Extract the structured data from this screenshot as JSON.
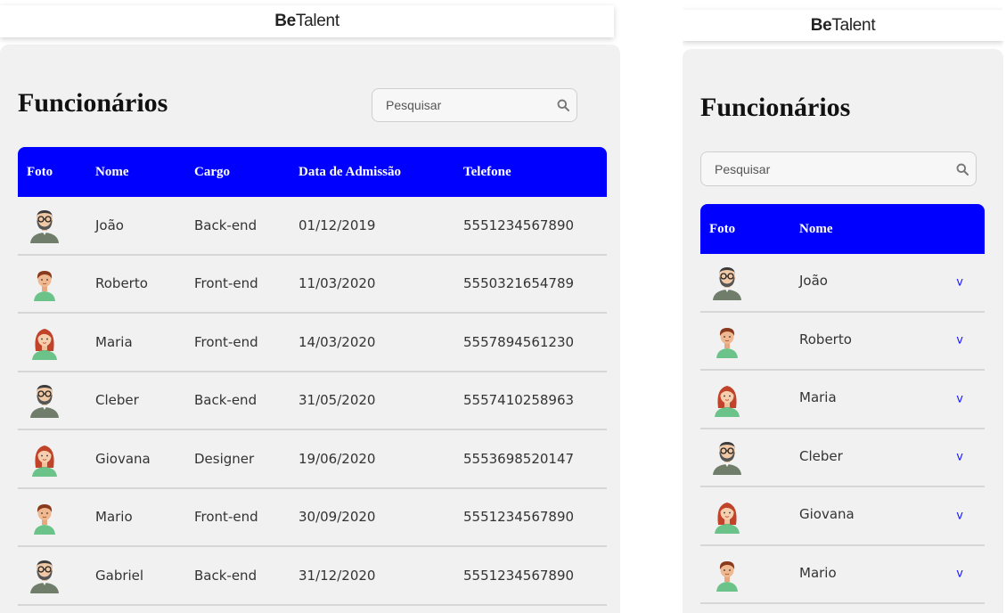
{
  "brand": {
    "bold": "Be",
    "regular": "Talent"
  },
  "title": "Funcionários",
  "search": {
    "placeholder": "Pesquisar"
  },
  "colors": {
    "header_bg": "#0000ff",
    "panel_bg": "#f1f1f1",
    "accent_text": "#1a1aff"
  },
  "columns": [
    "Foto",
    "Nome",
    "Cargo",
    "Data de Admissão",
    "Telefone"
  ],
  "mobile_columns": [
    "Foto",
    "Nome"
  ],
  "expand_label": "v",
  "employees": [
    {
      "photo": "man-glasses-avatar",
      "name": "João",
      "role": "Back-end",
      "admission": "01/12/2019",
      "phone": "5551234567890"
    },
    {
      "photo": "boy-avatar",
      "name": "Roberto",
      "role": "Front-end",
      "admission": "11/03/2020",
      "phone": "5550321654789"
    },
    {
      "photo": "woman-avatar",
      "name": "Maria",
      "role": "Front-end",
      "admission": "14/03/2020",
      "phone": "5557894561230"
    },
    {
      "photo": "man-glasses-avatar",
      "name": "Cleber",
      "role": "Back-end",
      "admission": "31/05/2020",
      "phone": "5557410258963"
    },
    {
      "photo": "woman-avatar",
      "name": "Giovana",
      "role": "Designer",
      "admission": "19/06/2020",
      "phone": "5553698520147"
    },
    {
      "photo": "boy-avatar",
      "name": "Mario",
      "role": "Front-end",
      "admission": "30/09/2020",
      "phone": "5551234567890"
    },
    {
      "photo": "man-glasses-avatar",
      "name": "Gabriel",
      "role": "Back-end",
      "admission": "31/12/2020",
      "phone": "5551234567890"
    }
  ]
}
